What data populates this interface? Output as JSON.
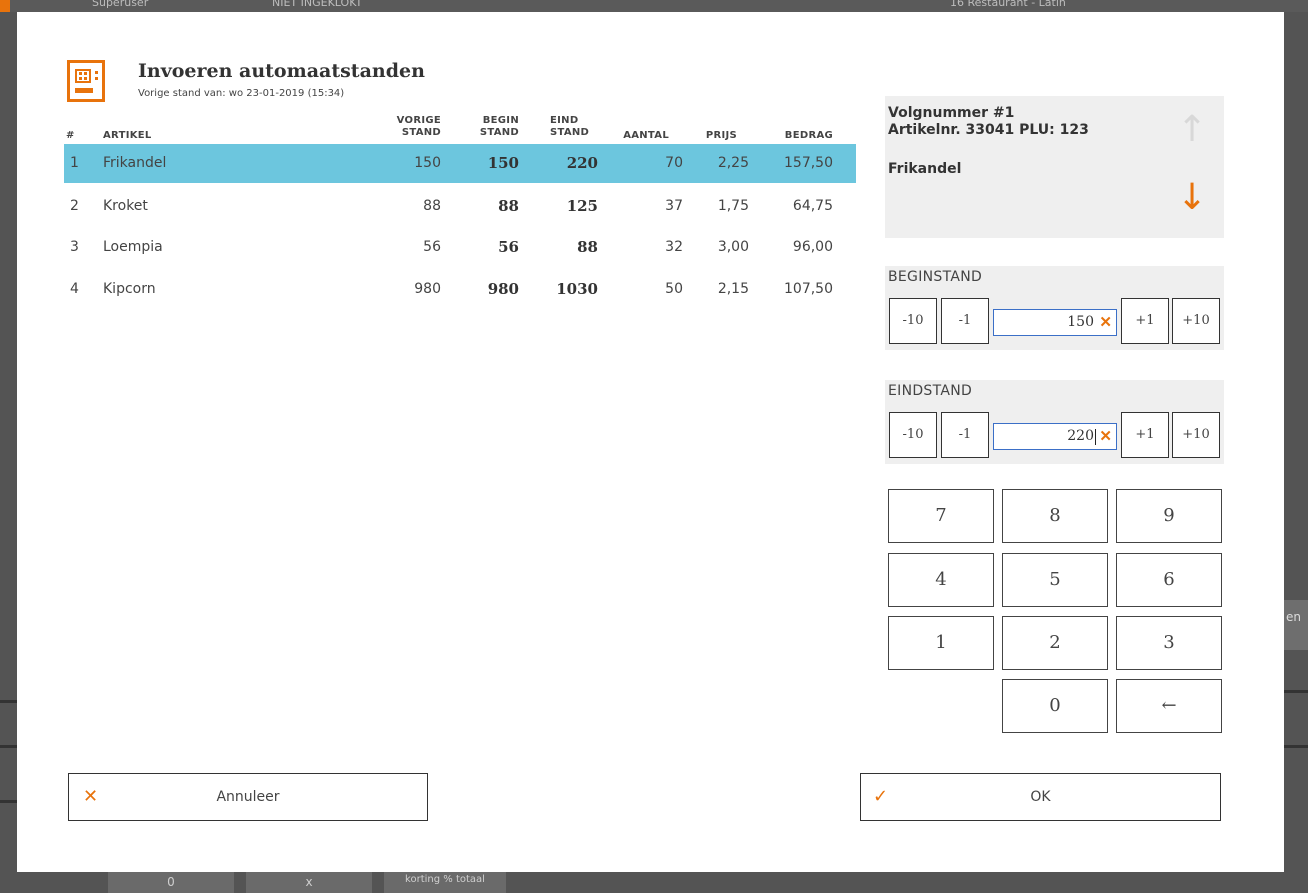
{
  "background": {
    "user_label": "Superuser",
    "clock_status": "NIET INGEKLOKT",
    "top_right": "16 Restaurant - Latin",
    "bottom_buttons": [
      "0",
      "x",
      "korting % totaal"
    ],
    "side_label": "en"
  },
  "dialog": {
    "title": "Invoeren automaatstanden",
    "subtitle": "Vorige stand van: wo 23-01-2019 (15:34)",
    "columns": {
      "num": "#",
      "artikel": "ARTIKEL",
      "vorige_1": "VORIGE",
      "vorige_2": "STAND",
      "begin_1": "BEGIN",
      "begin_2": "STAND",
      "eind_1": "EIND",
      "eind_2": "STAND",
      "aantal": "AANTAL",
      "prijs": "PRIJS",
      "bedrag": "BEDRAG"
    },
    "rows": [
      {
        "num": "1",
        "artikel": "Frikandel",
        "vorige": "150",
        "begin": "150",
        "eind": "220",
        "aantal": "70",
        "prijs": "2,25",
        "bedrag": "157,50"
      },
      {
        "num": "2",
        "artikel": "Kroket",
        "vorige": "88",
        "begin": "88",
        "eind": "125",
        "aantal": "37",
        "prijs": "1,75",
        "bedrag": "64,75"
      },
      {
        "num": "3",
        "artikel": "Loempia",
        "vorige": "56",
        "begin": "56",
        "eind": "88",
        "aantal": "32",
        "prijs": "3,00",
        "bedrag": "96,00"
      },
      {
        "num": "4",
        "artikel": "Kipcorn",
        "vorige": "980",
        "begin": "980",
        "eind": "1030",
        "aantal": "50",
        "prijs": "2,15",
        "bedrag": "107,50"
      }
    ],
    "selected_row": 0,
    "info": {
      "line1": "Volgnummer #1",
      "line2": "Artikelnr. 33041 PLU: 123",
      "line3": "Frikandel",
      "arrow_up_icon": "arrow-up-icon",
      "arrow_down_icon": "arrow-down-icon"
    },
    "beginstand": {
      "label": "BEGINSTAND",
      "minus10": "-10",
      "minus1": "-1",
      "value": "150",
      "plus1": "+1",
      "plus10": "+10"
    },
    "eindstand": {
      "label": "EINDSTAND",
      "minus10": "-10",
      "minus1": "-1",
      "value": "220",
      "plus1": "+1",
      "plus10": "+10"
    },
    "keypad": [
      "7",
      "8",
      "9",
      "4",
      "5",
      "6",
      "1",
      "2",
      "3",
      "0",
      "←"
    ],
    "cancel_label": "Annuleer",
    "ok_label": "OK",
    "colors": {
      "accent": "#e8730c",
      "selection": "#6cc6de",
      "input_border": "#3b6fc7"
    }
  }
}
